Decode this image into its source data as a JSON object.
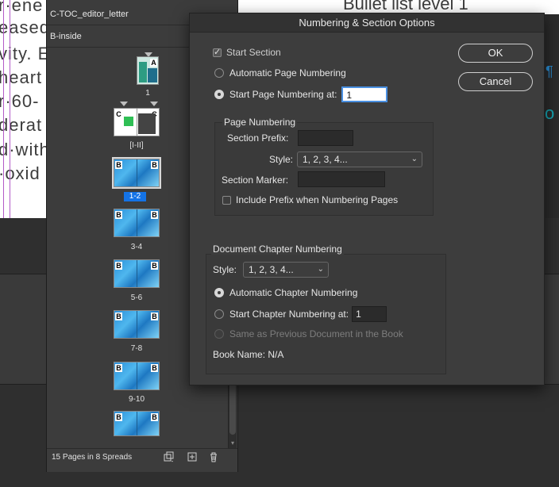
{
  "document": {
    "lines": [
      "r·ene",
      "eased",
      "vity. E",
      "heart",
      "r·60-",
      "derat",
      "d·with",
      "·oxid"
    ],
    "top_right_text": "Bullet list level 1",
    "pilcrow": "¶",
    "teal_fragment": "o",
    "colors": {
      "guide": "#b35bc7",
      "body_text": "#3d3d3d",
      "teal": "#16a7b5"
    }
  },
  "pages_panel": {
    "masters": [
      "C-TOC_editor_letter",
      "B-inside"
    ],
    "spreads": [
      {
        "label": "1",
        "prefixes": [
          "A"
        ],
        "selected": false
      },
      {
        "label": "[I-II]",
        "prefixes": [
          "C",
          "C"
        ],
        "selected": false
      },
      {
        "label": "1-2",
        "prefixes": [
          "B",
          "B"
        ],
        "selected": true
      },
      {
        "label": "3-4",
        "prefixes": [
          "B",
          "B"
        ],
        "selected": false
      },
      {
        "label": "5-6",
        "prefixes": [
          "B",
          "B"
        ],
        "selected": false
      },
      {
        "label": "7-8",
        "prefixes": [
          "B",
          "B"
        ],
        "selected": false
      },
      {
        "label": "9-10",
        "prefixes": [
          "B",
          "B"
        ],
        "selected": false
      },
      {
        "label": "",
        "prefixes": [
          "B",
          "B"
        ],
        "selected": false
      }
    ],
    "footer": {
      "count": "15 Pages in 8 Spreads",
      "icons": [
        "edit-page-size-icon",
        "new-page-icon",
        "trash-icon"
      ]
    },
    "colors": {
      "selection": "#1473e6"
    }
  },
  "dialog": {
    "title": "Numbering & Section Options",
    "start_section": {
      "label": "Start Section",
      "checked": true
    },
    "auto_page_numbering": {
      "label": "Automatic Page Numbering",
      "selected": false
    },
    "start_page_numbering": {
      "label": "Start Page Numbering at:",
      "selected": true,
      "value": "1"
    },
    "page_numbering": {
      "title": "Page Numbering",
      "section_prefix_label": "Section Prefix:",
      "section_prefix_value": "",
      "style_label": "Style:",
      "style_value": "1, 2, 3, 4...",
      "section_marker_label": "Section Marker:",
      "section_marker_value": "",
      "include_prefix_label": "Include Prefix when Numbering Pages",
      "include_prefix_checked": false
    },
    "chapter_numbering": {
      "title": "Document Chapter Numbering",
      "style_label": "Style:",
      "style_value": "1, 2, 3, 4...",
      "automatic_label": "Automatic Chapter Numbering",
      "start_label": "Start Chapter Numbering at:",
      "start_value": "1",
      "same_as_previous_label": "Same as Previous Document in the Book",
      "book_name": "Book Name: N/A"
    },
    "buttons": {
      "ok": "OK",
      "cancel": "Cancel"
    }
  }
}
